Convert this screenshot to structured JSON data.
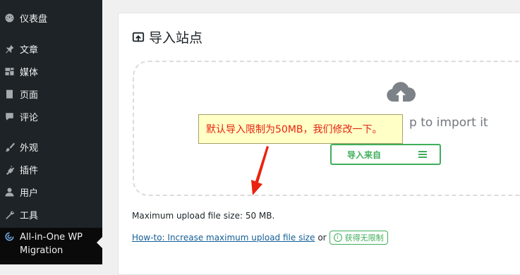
{
  "sidebar": {
    "items": [
      {
        "label": "仪表盘",
        "icon": "dashboard-icon"
      },
      {
        "label": "文章",
        "icon": "pushpin-icon"
      },
      {
        "label": "媒体",
        "icon": "media-icon"
      },
      {
        "label": "页面",
        "icon": "page-icon"
      },
      {
        "label": "评论",
        "icon": "comment-icon"
      },
      {
        "label": "外观",
        "icon": "brush-icon"
      },
      {
        "label": "插件",
        "icon": "plugin-icon"
      },
      {
        "label": "用户",
        "icon": "user-icon"
      },
      {
        "label": "工具",
        "icon": "wrench-icon"
      }
    ],
    "active_item": {
      "label_line1": "All-in-One WP",
      "label_line2": "Migration",
      "icon": "migration-icon"
    }
  },
  "panel": {
    "title": "导入站点",
    "drop_text": "p to import it",
    "import_button": "导入来自",
    "max_upload": "Maximum upload file size: 50 MB.",
    "howto_link": "How-to: Increase maximum upload file size",
    "or_text": "or",
    "unlimited_badge": "获得无限制"
  },
  "annotation": {
    "text": "默认导入限制为50MB，我们修改一下。"
  },
  "colors": {
    "sidebar_bg": "#1d2327",
    "accent_green": "#3fae5b",
    "link_blue": "#135e96",
    "annotation_red": "#e8230f",
    "annotation_bg": "#ffffc6"
  }
}
